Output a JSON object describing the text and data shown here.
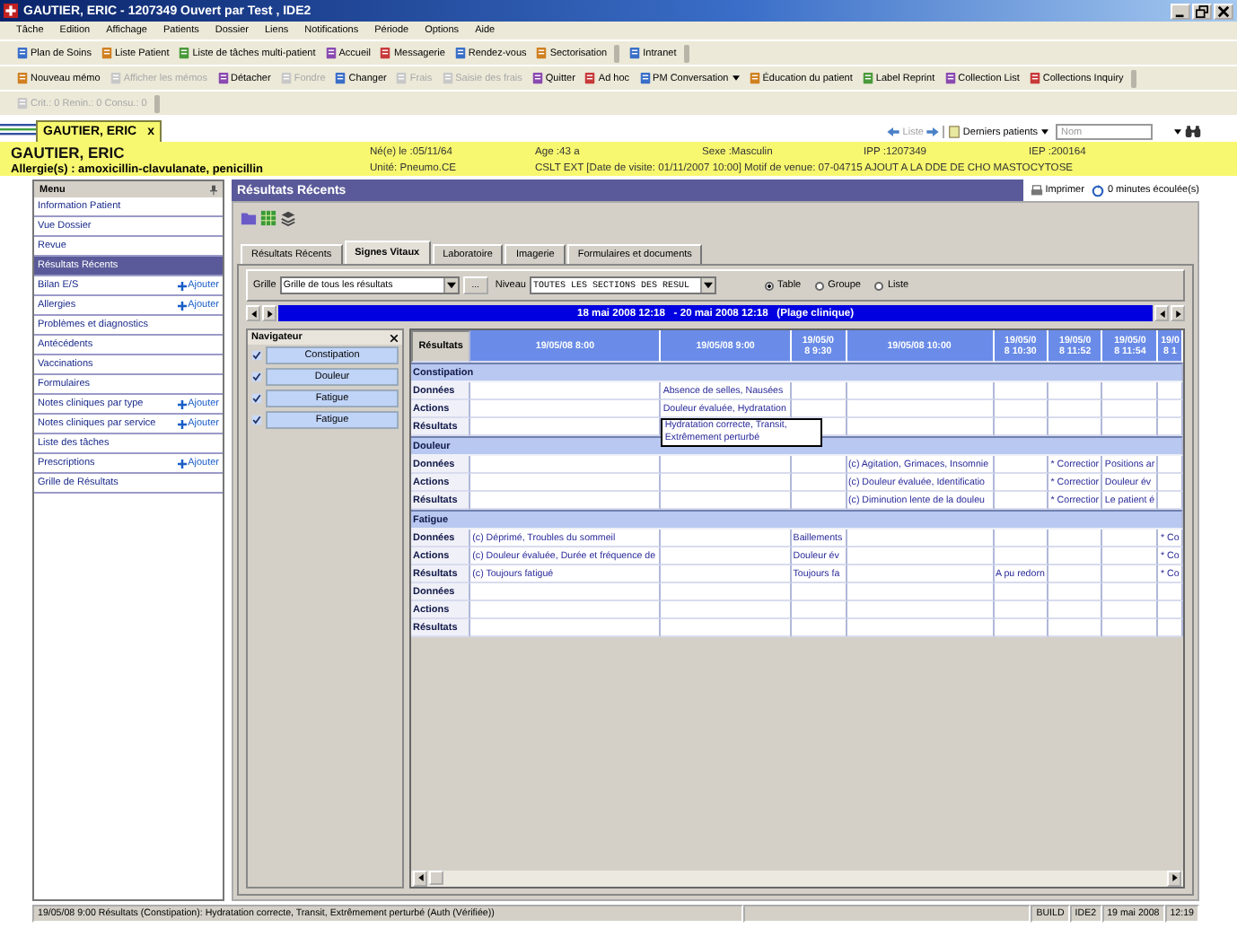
{
  "window": {
    "title": "GAUTIER, ERIC - 1207349 Ouvert par Test , IDE2"
  },
  "menu": [
    "Tâche",
    "Edition",
    "Affichage",
    "Patients",
    "Dossier",
    "Liens",
    "Notifications",
    "Période",
    "Options",
    "Aide"
  ],
  "toolbars": [
    [
      [
        {
          "label": "Plan de Soins",
          "disabled": false
        },
        {
          "label": "Liste Patient",
          "disabled": false
        },
        {
          "label": "Liste de tâches multi-patient",
          "disabled": false
        },
        {
          "label": "Accueil",
          "disabled": false
        },
        {
          "label": "Messagerie",
          "disabled": false
        },
        {
          "label": "Rendez-vous",
          "disabled": false
        },
        {
          "label": "Sectorisation",
          "disabled": false
        }
      ],
      [
        {
          "label": "Intranet",
          "disabled": false
        }
      ]
    ],
    [
      [
        {
          "label": "Nouveau mémo",
          "disabled": false
        },
        {
          "label": "Afficher les mémos",
          "disabled": true
        },
        {
          "label": "Détacher",
          "disabled": false
        },
        {
          "label": "Fondre",
          "disabled": true
        },
        {
          "label": "Changer",
          "disabled": false
        },
        {
          "label": "Frais",
          "disabled": true
        },
        {
          "label": "Saisie des frais",
          "disabled": true
        },
        {
          "label": "Quitter",
          "disabled": false
        },
        {
          "label": "Ad hoc",
          "disabled": false
        },
        {
          "label": "PM Conversation",
          "disabled": false,
          "dropdown": true
        },
        {
          "label": "Éducation du patient",
          "disabled": false
        },
        {
          "label": "Label Reprint",
          "disabled": false
        },
        {
          "label": "Collection List",
          "disabled": false
        },
        {
          "label": "Collections Inquiry",
          "disabled": false
        }
      ]
    ],
    [
      [
        {
          "label": "Crit.: 0  Renin.: 0  Consu.: 0",
          "disabled": true
        }
      ]
    ]
  ],
  "patient_tab": {
    "label": "GAUTIER, ERIC",
    "close": "x"
  },
  "patient_nav": {
    "list_label": "Liste",
    "list_disabled": true,
    "recent_label": "Derniers patients",
    "search": {
      "placeholder": "Nom"
    }
  },
  "banner": {
    "name": "GAUTIER, ERIC",
    "allergies": "Allergie(s) : amoxicillin-clavulanate, penicillin",
    "row1": [
      "Né(e) le :05/11/64",
      "Age :43 a",
      "Sexe :Masculin",
      "IPP :1207349",
      "IEP :200164"
    ],
    "row2": [
      "Unité: Pneumo.CE",
      "CSLT EXT [Date de visite: 01/11/2007 10:00] Motif de venue: 07-04715 AJOUT A LA DDE DE CHO MASTOCYTOSE"
    ]
  },
  "sidebar": {
    "title": "Menu",
    "items": [
      {
        "label": "Information Patient",
        "selected": false
      },
      {
        "label": "Vue Dossier",
        "selected": false
      },
      {
        "label": "Revue",
        "selected": false
      },
      {
        "label": "Résultats Récents",
        "selected": true
      },
      {
        "label": "Bilan E/S",
        "selected": false,
        "action": "Ajouter"
      },
      {
        "label": "Allergies",
        "selected": false,
        "action": "Ajouter"
      },
      {
        "label": "Problèmes et diagnostics",
        "selected": false
      },
      {
        "label": "Antécédents",
        "selected": false
      },
      {
        "label": "Vaccinations",
        "selected": false
      },
      {
        "label": "Formulaires",
        "selected": false
      },
      {
        "label": "Notes cliniques par type",
        "selected": false,
        "action": "Ajouter"
      },
      {
        "label": "Notes cliniques par service",
        "selected": false,
        "action": "Ajouter"
      },
      {
        "label": "Liste des tâches",
        "selected": false
      },
      {
        "label": "Prescriptions",
        "selected": false,
        "action": "Ajouter"
      },
      {
        "label": "Grille de Résultats",
        "selected": false
      }
    ]
  },
  "page": {
    "title": "Résultats Récents",
    "print_label": "Imprimer",
    "elapsed": "0 minutes écoulée(s)"
  },
  "tabs": [
    {
      "label": "Résultats Récents",
      "selected": false
    },
    {
      "label": "Signes Vitaux",
      "selected": true
    },
    {
      "label": "Laboratoire",
      "selected": false
    },
    {
      "label": "Imagerie",
      "selected": false
    },
    {
      "label": "Formulaires et documents",
      "selected": false
    }
  ],
  "filter": {
    "grid_label": "Grille",
    "grid_value": "Grille de tous les résultats",
    "more_button": "...",
    "level_label": "Niveau",
    "level_value": "TOUTES LES SECTIONS DES RESUL",
    "views": [
      {
        "label": "Table",
        "selected": true
      },
      {
        "label": "Groupe",
        "selected": false
      },
      {
        "label": "Liste",
        "selected": false
      }
    ]
  },
  "date_range": "18 mai 2008 12:18   - 20 mai 2008 12:18   (Plage clinique)",
  "navigator": {
    "title": "Navigateur",
    "items": [
      {
        "label": "Constipation",
        "checked": true
      },
      {
        "label": "Douleur",
        "checked": true
      },
      {
        "label": "Fatigue",
        "checked": true
      },
      {
        "label": "Fatigue",
        "checked": true
      }
    ]
  },
  "grid": {
    "corner": "Résultats",
    "columns": [
      {
        "lines": [
          "19/05/08 8:00"
        ]
      },
      {
        "lines": [
          "19/05/08 9:00"
        ]
      },
      {
        "lines": [
          "19/05/0",
          "8 9:30"
        ]
      },
      {
        "lines": [
          "19/05/08 10:00"
        ]
      },
      {
        "lines": [
          "19/05/0",
          "8 10:30"
        ]
      },
      {
        "lines": [
          "19/05/0",
          "8 11:52"
        ]
      },
      {
        "lines": [
          "19/05/0",
          "8 11:54"
        ]
      },
      {
        "lines": [
          "19/0",
          "8 1"
        ]
      }
    ],
    "sections": [
      {
        "title": "Constipation",
        "rows": [
          {
            "label": "Données",
            "cells": [
              null,
              "Absence de selles, Nausées",
              null,
              null,
              null,
              null,
              null,
              null
            ]
          },
          {
            "label": "Actions",
            "cells": [
              null,
              "Douleur évaluée, Hydratation",
              null,
              null,
              null,
              null,
              null,
              null
            ]
          },
          {
            "label": "Résultats",
            "cells": [
              null,
              {
                "tooltip": "Hydratation correcte, Transit, Extrêmement perturbé"
              },
              null,
              null,
              null,
              null,
              null,
              null
            ]
          }
        ]
      },
      {
        "title": "Douleur",
        "rows": [
          {
            "label": "Données",
            "cells": [
              null,
              null,
              null,
              "(c) Agitation, Grimaces, Insomnie",
              null,
              "* Correctior",
              "Positions ar",
              null
            ]
          },
          {
            "label": "Actions",
            "cells": [
              null,
              null,
              null,
              "(c) Douleur évaluée, Identificatio",
              null,
              "* Correctior",
              "Douleur év",
              null
            ]
          },
          {
            "label": "Résultats",
            "cells": [
              null,
              null,
              null,
              "(c) Diminution lente de la douleu",
              null,
              "* Correctior",
              "Le patient é",
              null
            ]
          }
        ]
      },
      {
        "title": "Fatigue",
        "rows": [
          {
            "label": "Données",
            "cells": [
              "(c) Déprimé, Troubles du sommeil",
              null,
              "Baillements",
              null,
              null,
              null,
              null,
              "* Co"
            ]
          },
          {
            "label": "Actions",
            "cells": [
              "(c) Douleur évaluée, Durée et fréquence de",
              null,
              "Douleur év",
              null,
              null,
              null,
              null,
              "* Co"
            ]
          },
          {
            "label": "Résultats",
            "cells": [
              "(c) Toujours fatigué",
              null,
              "Toujours fa",
              null,
              "A pu redorn",
              null,
              null,
              "* Co"
            ]
          }
        ]
      },
      {
        "rows": [
          {
            "label": "Données",
            "cells": [
              null,
              null,
              null,
              null,
              null,
              null,
              null,
              null
            ]
          },
          {
            "label": "Actions",
            "cells": [
              null,
              null,
              null,
              null,
              null,
              null,
              null,
              null
            ]
          },
          {
            "label": "Résultats",
            "cells": [
              null,
              null,
              null,
              null,
              null,
              null,
              null,
              null
            ]
          }
        ]
      }
    ]
  },
  "status_bar": {
    "message": "19/05/08 9:00   Résultats (Constipation): Hydratation correcte, Transit, Extrêmement perturbé (Auth (Vérifiée))",
    "panels": [
      "BUILD",
      "IDE2",
      "19 mai 2008",
      "12:19"
    ]
  }
}
